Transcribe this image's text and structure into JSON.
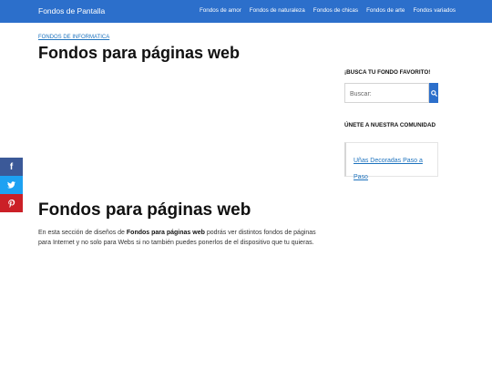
{
  "header": {
    "brand": "Fondos de Pantalla",
    "nav": [
      "Fondos de amor",
      "Fondos de naturaleza",
      "Fondos de chicas",
      "Fondos de arte",
      "Fondos variados"
    ]
  },
  "breadcrumb": "FONDOS DE INFORMATICA",
  "page_title": "Fondos para páginas web",
  "section_title": "Fondos para páginas web",
  "intro": {
    "before": "En esta sección de diseños de ",
    "bold": "Fondos para páginas web",
    "after": " podrás ver distintos fondos de páginas para Internet y no solo para Webs si no también puedes ponerlos de el dispositivo que tu quieras."
  },
  "sidebar": {
    "search_title": "¡BUSCA TU FONDO FAVORITO!",
    "search_placeholder": "Buscar:",
    "community_title": "ÚNETE A NUESTRA COMUNIDAD",
    "community_link": "Uñas Decoradas Paso a Paso"
  },
  "share": {
    "facebook": "f",
    "colors": {
      "facebook": "#3b5998",
      "twitter": "#1da1f2",
      "pinterest": "#cb2027"
    }
  },
  "colors": {
    "header": "#2c6fcb",
    "link": "#1e73be"
  }
}
